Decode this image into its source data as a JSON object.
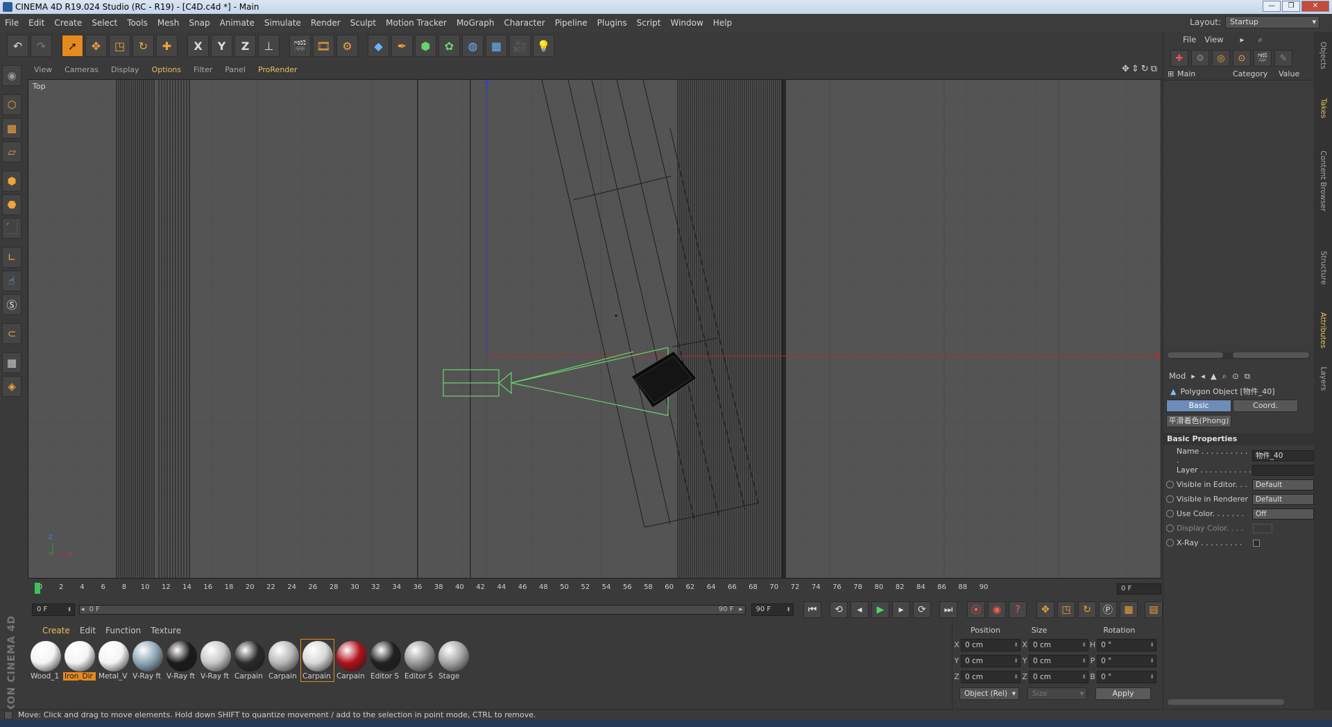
{
  "window": {
    "title": "CINEMA 4D R19.024 Studio (RC - R19) - [C4D.c4d *] - Main"
  },
  "menubar": {
    "items": [
      "File",
      "Edit",
      "Create",
      "Select",
      "Tools",
      "Mesh",
      "Snap",
      "Animate",
      "Simulate",
      "Render",
      "Sculpt",
      "Motion Tracker",
      "MoGraph",
      "Character",
      "Pipeline",
      "Plugins",
      "Script",
      "Window",
      "Help"
    ],
    "layout_label": "Layout:",
    "layout_value": "Startup"
  },
  "toolbar": {
    "icons": [
      "undo-icon",
      "redo-icon",
      "live-selection-icon",
      "move-icon",
      "scale-icon",
      "rotate-icon",
      "recent-tools-icon",
      "x-axis-icon",
      "y-axis-icon",
      "z-axis-icon",
      "coordinate-system-icon",
      "render-view-icon",
      "render-to-picture-viewer-icon",
      "edit-render-settings-icon",
      "cube-icon",
      "pen-spline-icon",
      "subdivision-icon",
      "array-icon",
      "deformer-icon",
      "floor-icon",
      "camera-icon",
      "light-icon"
    ],
    "x_label": "X",
    "y_label": "Y",
    "z_label": "Z"
  },
  "viewport": {
    "menu": [
      "View",
      "Cameras",
      "Display",
      "Options",
      "Filter",
      "Panel",
      "ProRender"
    ],
    "active_menu": "Options",
    "label": "Top",
    "axis_y": "Y",
    "axis_x": "X",
    "axis_z": "Z"
  },
  "timeline": {
    "ticks": [
      "0",
      "2",
      "4",
      "6",
      "8",
      "10",
      "12",
      "14",
      "16",
      "18",
      "20",
      "22",
      "24",
      "26",
      "28",
      "30",
      "32",
      "34",
      "36",
      "38",
      "40",
      "42",
      "44",
      "46",
      "48",
      "50",
      "52",
      "54",
      "56",
      "58",
      "60",
      "62",
      "64",
      "66",
      "68",
      "70",
      "72",
      "74",
      "76",
      "78",
      "80",
      "82",
      "84",
      "86",
      "88",
      "90"
    ],
    "current_frame": "0 F"
  },
  "transport": {
    "start_frame": "0 F",
    "range_start": "0 F",
    "range_end": "90 F",
    "end_frame": "90 F"
  },
  "material_manager": {
    "menu": [
      "Create",
      "Edit",
      "Function",
      "Texture"
    ],
    "materials": [
      {
        "label": "Wood_1",
        "color": "#f4f4f4",
        "selected": false
      },
      {
        "label": "Iron_Dir",
        "color": "#f4f4f4",
        "selected": true
      },
      {
        "label": "Metal_V",
        "color": "#f4f4f4",
        "selected": false
      },
      {
        "label": "V-Ray ft",
        "color": "#8fa7b8",
        "selected": false
      },
      {
        "label": "V-Ray ft",
        "color": "#1a1a1a",
        "selected": false
      },
      {
        "label": "V-Ray ft",
        "color": "#c8c8c8",
        "selected": false
      },
      {
        "label": "Carpain",
        "color": "#2a2a2a",
        "selected": false
      },
      {
        "label": "Carpain",
        "color": "#b8b8b8",
        "selected": false
      },
      {
        "label": "Carpain",
        "color": "#d8d8d8",
        "selected": false
      },
      {
        "label": "Carpain",
        "color": "#b0101a",
        "selected": false
      },
      {
        "label": "Editor S",
        "color": "#202020",
        "selected": false
      },
      {
        "label": "Editor S",
        "color": "#9a9a9a",
        "selected": false
      },
      {
        "label": "Stage",
        "color": "#a6a6a6",
        "selected": false
      }
    ]
  },
  "coordinates": {
    "headers": [
      "Position",
      "Size",
      "Rotation"
    ],
    "rows": [
      {
        "axis": "X",
        "pos": "0 cm",
        "size_axis": "X",
        "size": "0 cm",
        "rot_axis": "H",
        "rot": "0 °"
      },
      {
        "axis": "Y",
        "pos": "0 cm",
        "size_axis": "Y",
        "size": "0 cm",
        "rot_axis": "P",
        "rot": "0 °"
      },
      {
        "axis": "Z",
        "pos": "0 cm",
        "size_axis": "Z",
        "size": "0 cm",
        "rot_axis": "B",
        "rot": "0 °"
      }
    ],
    "mode": "Object (Rel)",
    "size_mode": "Size",
    "apply": "Apply"
  },
  "status": {
    "text": "Move: Click and drag to move elements. Hold down SHIFT to quantize movement / add to the selection in point mode, CTRL to remove."
  },
  "object_manager": {
    "menu": [
      "File",
      "View"
    ],
    "columns": [
      "Main",
      "Category",
      "Value"
    ]
  },
  "attributes": {
    "menu_label": "Mod",
    "object_title": "Polygon Object [物件_40]",
    "tabs": [
      "Basic",
      "Coord."
    ],
    "phong_tab": "平滑着色(Phong)",
    "section": "Basic Properties",
    "rows": [
      {
        "label": "Name . . . . . . . . . . .",
        "value": "物件_40",
        "kind": "text",
        "radio": false
      },
      {
        "label": "Layer . . . . . . . . . . .",
        "value": "",
        "kind": "text",
        "radio": false
      },
      {
        "label": "Visible in Editor. . .",
        "value": "Default",
        "kind": "dd",
        "radio": true
      },
      {
        "label": "Visible in Renderer",
        "value": "Default",
        "kind": "dd",
        "radio": true
      },
      {
        "label": "Use Color. . . . . . .",
        "value": "Off",
        "kind": "dd",
        "radio": true
      },
      {
        "label": "Display Color. . . .",
        "value": "",
        "kind": "swatch",
        "radio": true,
        "disabled": true
      },
      {
        "label": "X-Ray . . . . . . . . .",
        "value": "",
        "kind": "check",
        "radio": true
      }
    ]
  },
  "side_tabs": [
    "Objects",
    "Takes",
    "Content Browser",
    "Structure",
    "Attributes",
    "Layers"
  ]
}
